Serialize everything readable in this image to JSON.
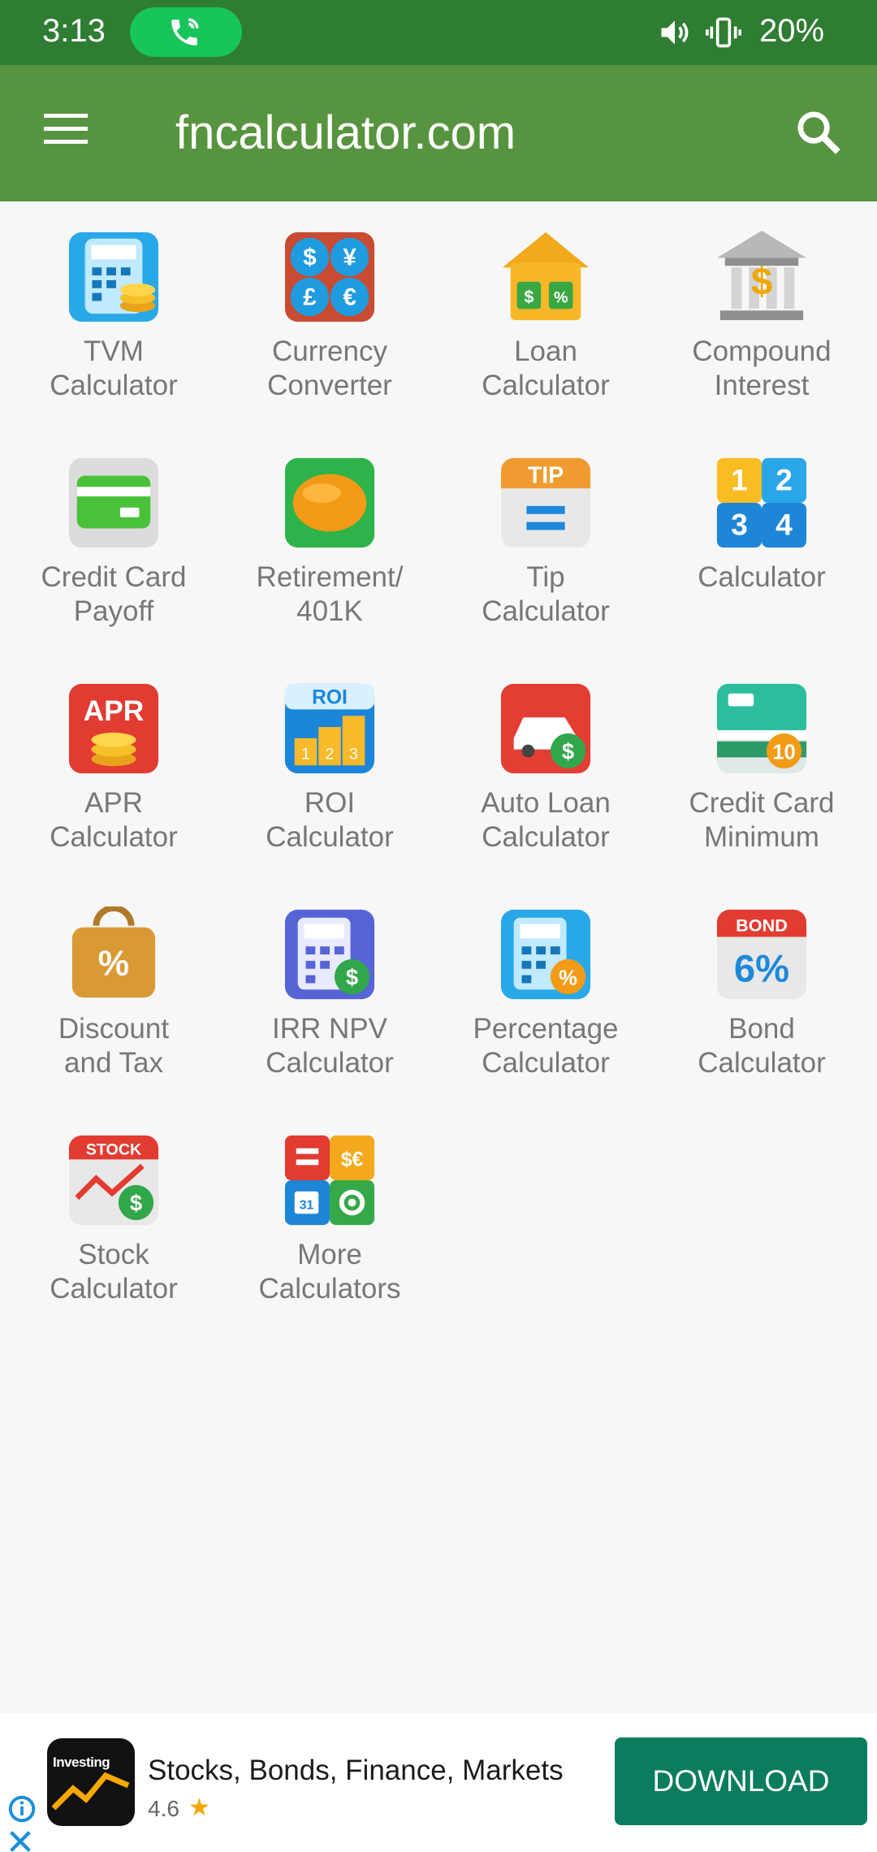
{
  "status_bar": {
    "time": "3:13",
    "battery": "20%"
  },
  "app_bar": {
    "title": "fncalculator.com"
  },
  "tiles": [
    {
      "label": "TVM\nCalculator"
    },
    {
      "label": "Currency\nConverter"
    },
    {
      "label": "Loan\nCalculator"
    },
    {
      "label": "Compound\nInterest"
    },
    {
      "label": "Credit Card\nPayoff"
    },
    {
      "label": "Retirement/\n401K"
    },
    {
      "label": "Tip\nCalculator"
    },
    {
      "label": "Calculator"
    },
    {
      "label": "APR\nCalculator"
    },
    {
      "label": "ROI\nCalculator"
    },
    {
      "label": "Auto Loan\nCalculator"
    },
    {
      "label": "Credit Card\nMinimum"
    },
    {
      "label": "Discount\nand Tax"
    },
    {
      "label": "IRR NPV\nCalculator"
    },
    {
      "label": "Percentage\nCalculator"
    },
    {
      "label": "Bond\nCalculator"
    },
    {
      "label": "Stock\nCalculator"
    },
    {
      "label": "More\nCalculators"
    }
  ],
  "ad": {
    "icon_text": "Investing",
    "title": "Stocks, Bonds, Finance, Markets",
    "rating": "4.6",
    "button": "DOWNLOAD"
  }
}
